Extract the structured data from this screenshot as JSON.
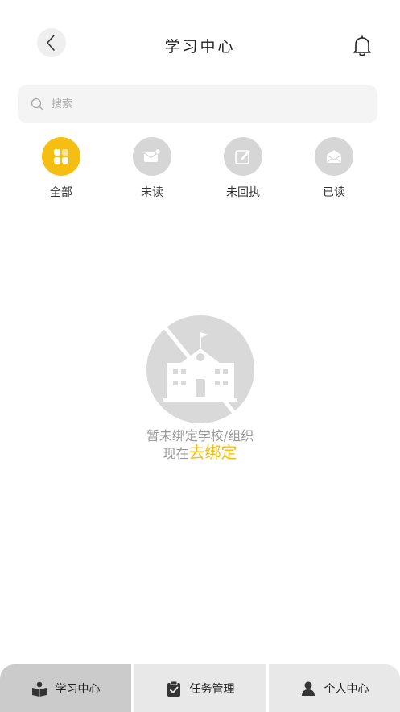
{
  "header": {
    "title": "学习中心",
    "back_icon": "chevron-left-icon",
    "notification_icon": "bell-icon"
  },
  "search": {
    "placeholder": "搜索",
    "value": ""
  },
  "filters": [
    {
      "label": "全部",
      "icon": "grid-icon",
      "active": true
    },
    {
      "label": "未读",
      "icon": "mail-unread-icon",
      "active": false
    },
    {
      "label": "未回执",
      "icon": "edit-icon",
      "active": false
    },
    {
      "label": "已读",
      "icon": "mail-open-icon",
      "active": false
    }
  ],
  "empty_state": {
    "icon": "school-crossed-icon",
    "message": "暂未绑定学校/组织",
    "prompt_prefix": "现在",
    "bind_link": "去绑定"
  },
  "tabbar": [
    {
      "label": "学习中心",
      "icon": "book-reader-icon",
      "active": true
    },
    {
      "label": "任务管理",
      "icon": "clipboard-check-icon",
      "active": false
    },
    {
      "label": "个人中心",
      "icon": "user-icon",
      "active": false
    }
  ],
  "colors": {
    "accent": "#f5be12",
    "inactive_circle": "#d6d6d6",
    "tab_bg": "#e8e8e8",
    "tab_active_bg": "#cbcbcb",
    "empty_text": "#9a9a9a"
  }
}
